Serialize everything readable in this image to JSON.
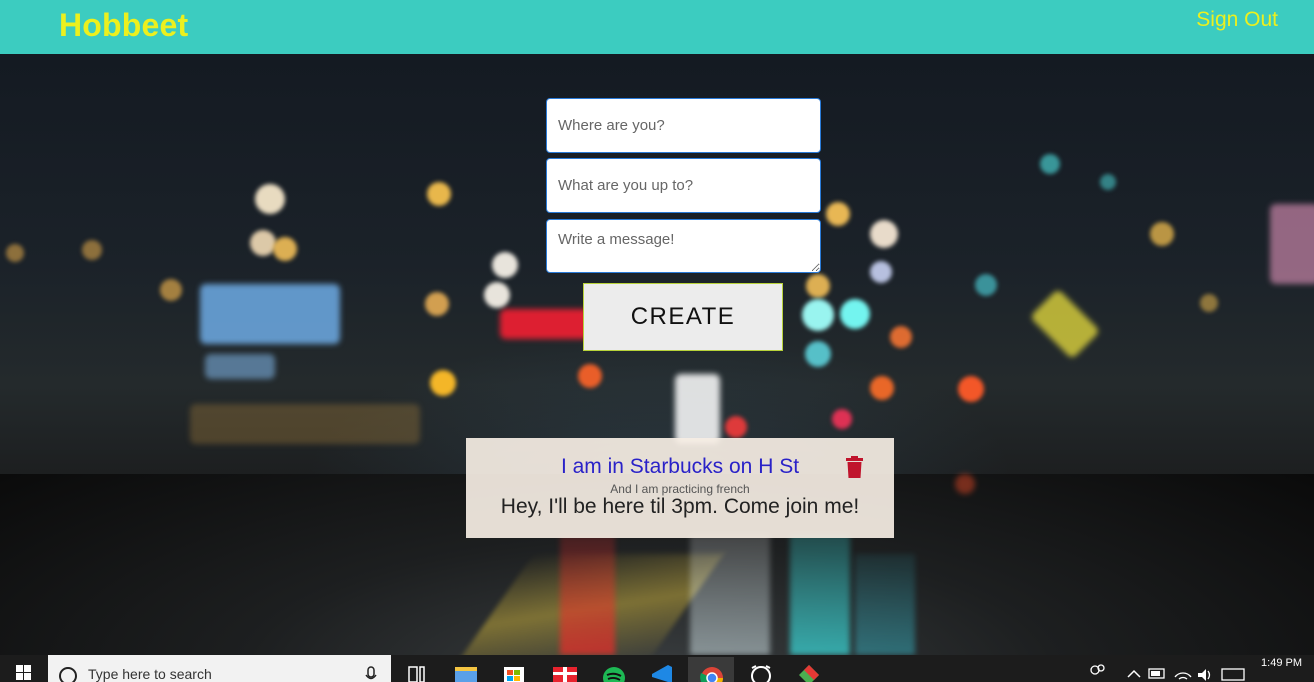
{
  "header": {
    "brand": "Hobbeet",
    "sign_out": "Sign Out"
  },
  "form": {
    "where_placeholder": "Where are you?",
    "what_placeholder": "What are you up to?",
    "message_placeholder": "Write a message!",
    "create_label": "CREATE"
  },
  "post": {
    "title": "I am in Starbucks on H St",
    "subtitle": "And I am practicing french",
    "message": "Hey, I'll be here til 3pm. Come join me!"
  },
  "taskbar": {
    "search_placeholder": "Type here to search",
    "time": "1:49 PM"
  },
  "colors": {
    "header_bg": "#3cccc0",
    "brand": "#ecf01e",
    "post_title": "#2a22c8",
    "trash": "#c0142c"
  }
}
